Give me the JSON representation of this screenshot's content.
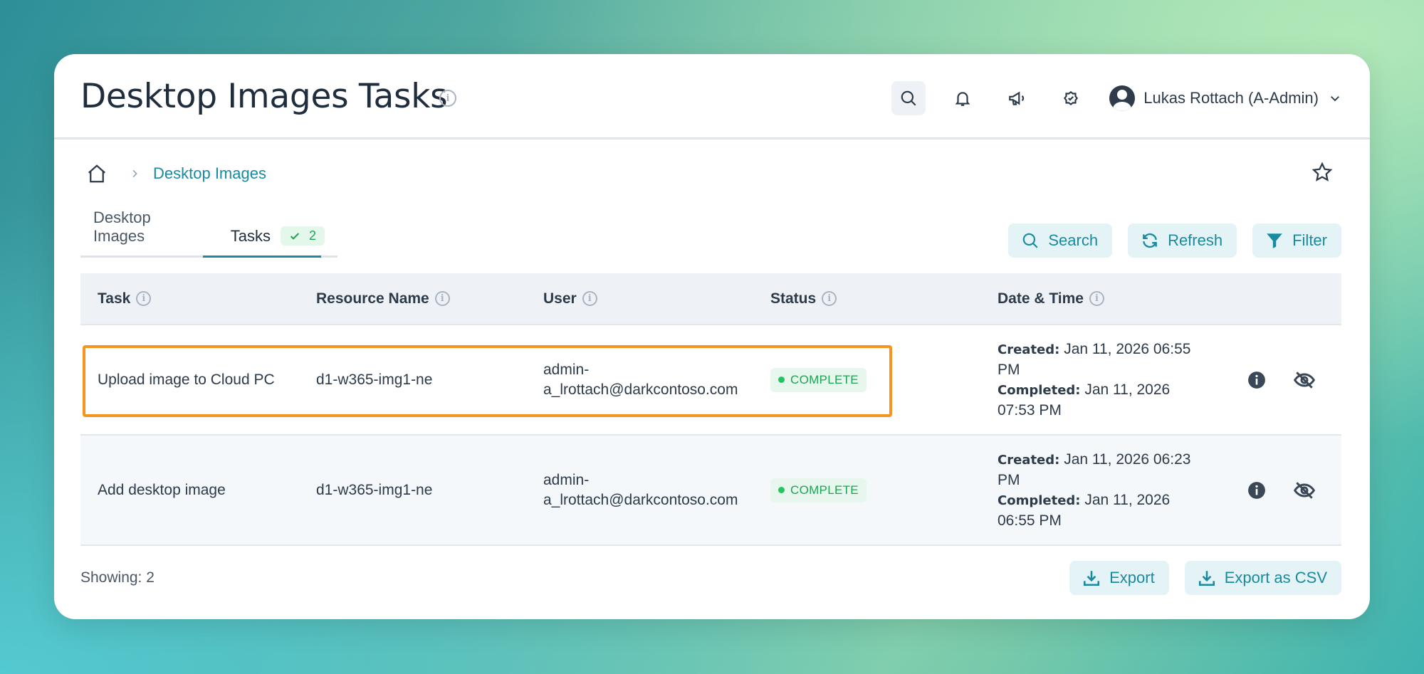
{
  "header": {
    "title": "Desktop Images Tasks",
    "user_name": "Lukas Rottach (A-Admin)"
  },
  "breadcrumb": {
    "current": "Desktop Images"
  },
  "tabs": [
    {
      "label": "Desktop Images"
    },
    {
      "label": "Tasks",
      "badge": "2"
    }
  ],
  "toolbar": {
    "search_label": "Search",
    "refresh_label": "Refresh",
    "filter_label": "Filter"
  },
  "table": {
    "columns": [
      "Task",
      "Resource Name",
      "User",
      "Status",
      "Date & Time"
    ],
    "rows": [
      {
        "task": "Upload image to Cloud PC",
        "resource": "d1-w365-img1-ne",
        "user_line1": "admin-",
        "user_line2": "a_lrottach@darkcontoso.com",
        "status": "COMPLETE",
        "created_label": "Created:",
        "created": "Jan 11, 2026 06:55 PM",
        "completed_label": "Completed:",
        "completed": "Jan 11, 2026 07:53 PM",
        "highlighted": true
      },
      {
        "task": "Add desktop image",
        "resource": "d1-w365-img1-ne",
        "user_line1": "admin-",
        "user_line2": "a_lrottach@darkcontoso.com",
        "status": "COMPLETE",
        "created_label": "Created:",
        "created": "Jan 11, 2026 06:23 PM",
        "completed_label": "Completed:",
        "completed": "Jan 11, 2026 06:55 PM",
        "highlighted": false
      }
    ]
  },
  "footer": {
    "showing": "Showing: 2",
    "export_label": "Export",
    "export_csv_label": "Export as CSV"
  },
  "colors": {
    "accent": "#1a8aa0",
    "status_green": "#1fa354",
    "highlight": "#f7931e"
  }
}
